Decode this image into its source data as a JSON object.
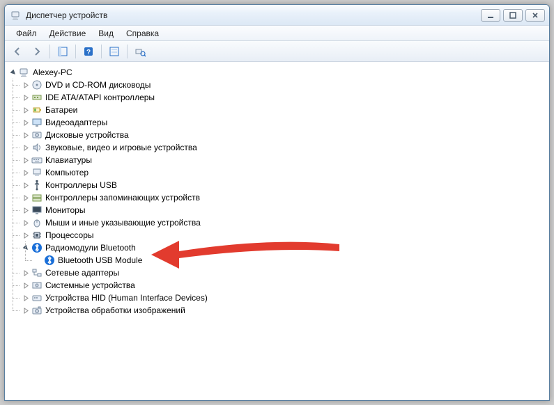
{
  "window": {
    "title": "Диспетчер устройств"
  },
  "menu": {
    "file": "Файл",
    "action": "Действие",
    "view": "Вид",
    "help": "Справка"
  },
  "tree": {
    "root": "Alexey-PC",
    "items": [
      {
        "label": "DVD и CD-ROM дисководы",
        "icon": "disc"
      },
      {
        "label": "IDE ATA/ATAPI контроллеры",
        "icon": "ide"
      },
      {
        "label": "Батареи",
        "icon": "battery"
      },
      {
        "label": "Видеоадаптеры",
        "icon": "display"
      },
      {
        "label": "Дисковые устройства",
        "icon": "disk"
      },
      {
        "label": "Звуковые, видео и игровые устройства",
        "icon": "sound"
      },
      {
        "label": "Клавиатуры",
        "icon": "keyboard"
      },
      {
        "label": "Компьютер",
        "icon": "computer"
      },
      {
        "label": "Контроллеры USB",
        "icon": "usb"
      },
      {
        "label": "Контроллеры запоминающих устройств",
        "icon": "storage"
      },
      {
        "label": "Мониторы",
        "icon": "monitor"
      },
      {
        "label": "Мыши и иные указывающие устройства",
        "icon": "mouse"
      },
      {
        "label": "Процессоры",
        "icon": "cpu"
      },
      {
        "label": "Радиомодули Bluetooth",
        "icon": "bluetooth",
        "expanded": true,
        "children": [
          {
            "label": "Bluetooth USB Module",
            "icon": "bluetooth"
          }
        ]
      },
      {
        "label": "Сетевые адаптеры",
        "icon": "network"
      },
      {
        "label": "Системные устройства",
        "icon": "system"
      },
      {
        "label": "Устройства HID (Human Interface Devices)",
        "icon": "hid"
      },
      {
        "label": "Устройства обработки изображений",
        "icon": "imaging"
      }
    ]
  }
}
